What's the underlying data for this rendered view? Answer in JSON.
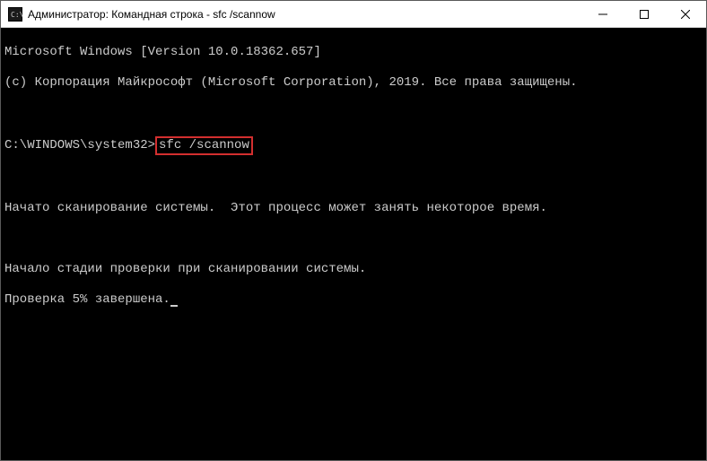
{
  "titlebar": {
    "text": "Администратор: Командная строка - sfc  /scannow"
  },
  "console": {
    "line1": "Microsoft Windows [Version 10.0.18362.657]",
    "line2": "(c) Корпорация Майкрософт (Microsoft Corporation), 2019. Все права защищены.",
    "prompt": "C:\\WINDOWS\\system32>",
    "command": "sfc /scannow",
    "line3": "Начато сканирование системы.  Этот процесс может занять некоторое время.",
    "line4": "Начало стадии проверки при сканировании системы.",
    "line5": "Проверка 5% завершена."
  }
}
